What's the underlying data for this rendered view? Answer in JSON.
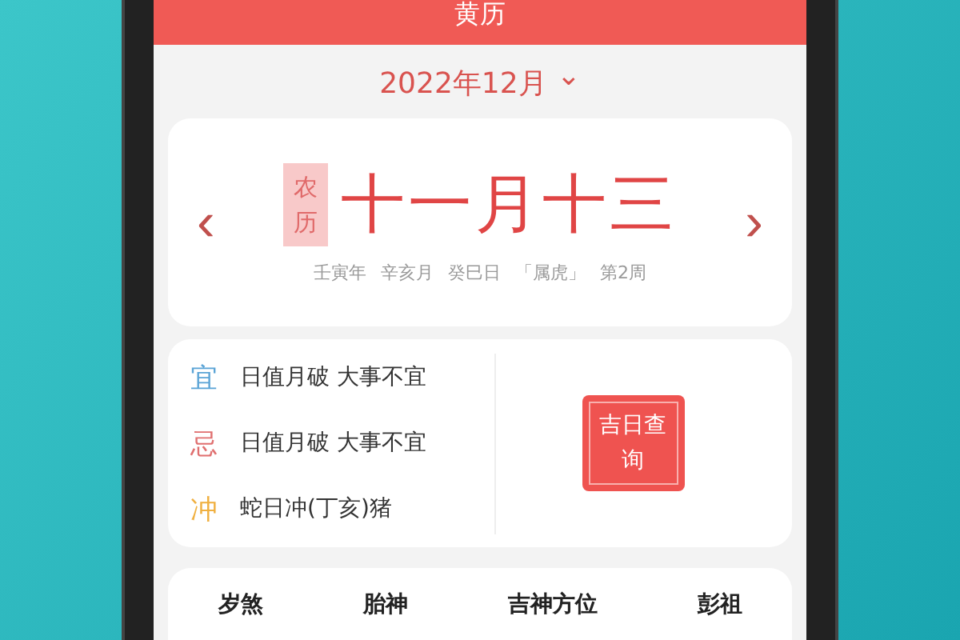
{
  "header": {
    "title": "黄历"
  },
  "month_picker": {
    "label": "2022年12月",
    "caret": "⌄"
  },
  "lunar_card": {
    "tag": "农历",
    "date": "十一月十三",
    "prev": "‹",
    "next": "›",
    "details": [
      "壬寅年",
      "辛亥月",
      "癸巳日",
      "「属虎」",
      "第2周"
    ]
  },
  "almanac": {
    "rows": [
      {
        "key": "宜",
        "text": "日值月破 大事不宜",
        "color": "#5ba4d6"
      },
      {
        "key": "忌",
        "text": "日值月破 大事不宜",
        "color": "#e07070"
      },
      {
        "key": "冲",
        "text": "蛇日冲(丁亥)猪",
        "color": "#f0b040"
      }
    ],
    "button": "吉日查询"
  },
  "info_tabs": [
    "岁煞",
    "胎神",
    "吉神方位",
    "彭祖"
  ]
}
